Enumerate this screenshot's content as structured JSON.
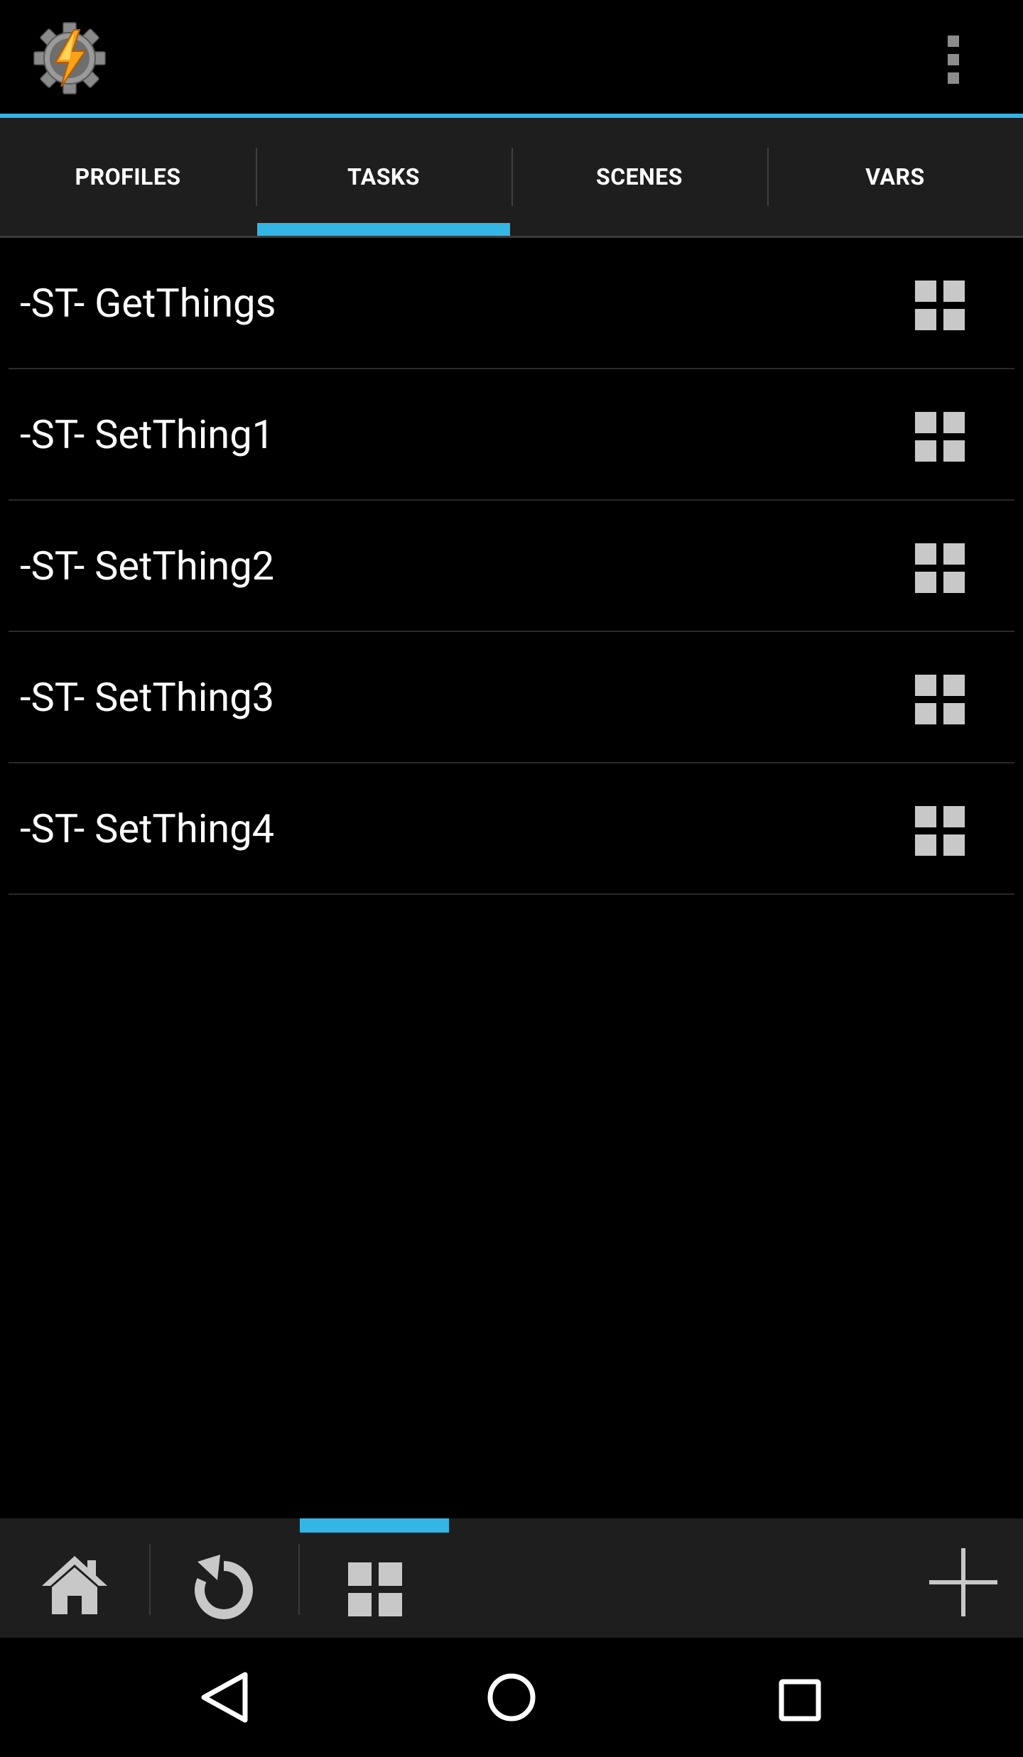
{
  "app": {
    "icon": "tasker-gear-bolt-icon",
    "overflow_icon": "overflow-menu-icon"
  },
  "tabs": [
    {
      "label": "PROFILES",
      "selected": false
    },
    {
      "label": "TASKS",
      "selected": true
    },
    {
      "label": "SCENES",
      "selected": false
    },
    {
      "label": "VARS",
      "selected": false
    }
  ],
  "tasks": [
    {
      "name": "-ST- GetThings",
      "icon": "grid-icon"
    },
    {
      "name": "-ST- SetThing1",
      "icon": "grid-icon"
    },
    {
      "name": "-ST- SetThing2",
      "icon": "grid-icon"
    },
    {
      "name": "-ST- SetThing3",
      "icon": "grid-icon"
    },
    {
      "name": "-ST- SetThing4",
      "icon": "grid-icon"
    }
  ],
  "bottom_toolbar": {
    "buttons": [
      "home-icon",
      "refresh-icon",
      "grid-icon",
      "add-icon"
    ],
    "selected": "grid-icon"
  },
  "system_nav": [
    "back-icon",
    "home-circle-icon",
    "recents-icon"
  ],
  "colors": {
    "accent": "#33b5e5",
    "background": "#000000",
    "bar_background": "#1e1e1e",
    "icon_gray": "#c8c8c8"
  }
}
